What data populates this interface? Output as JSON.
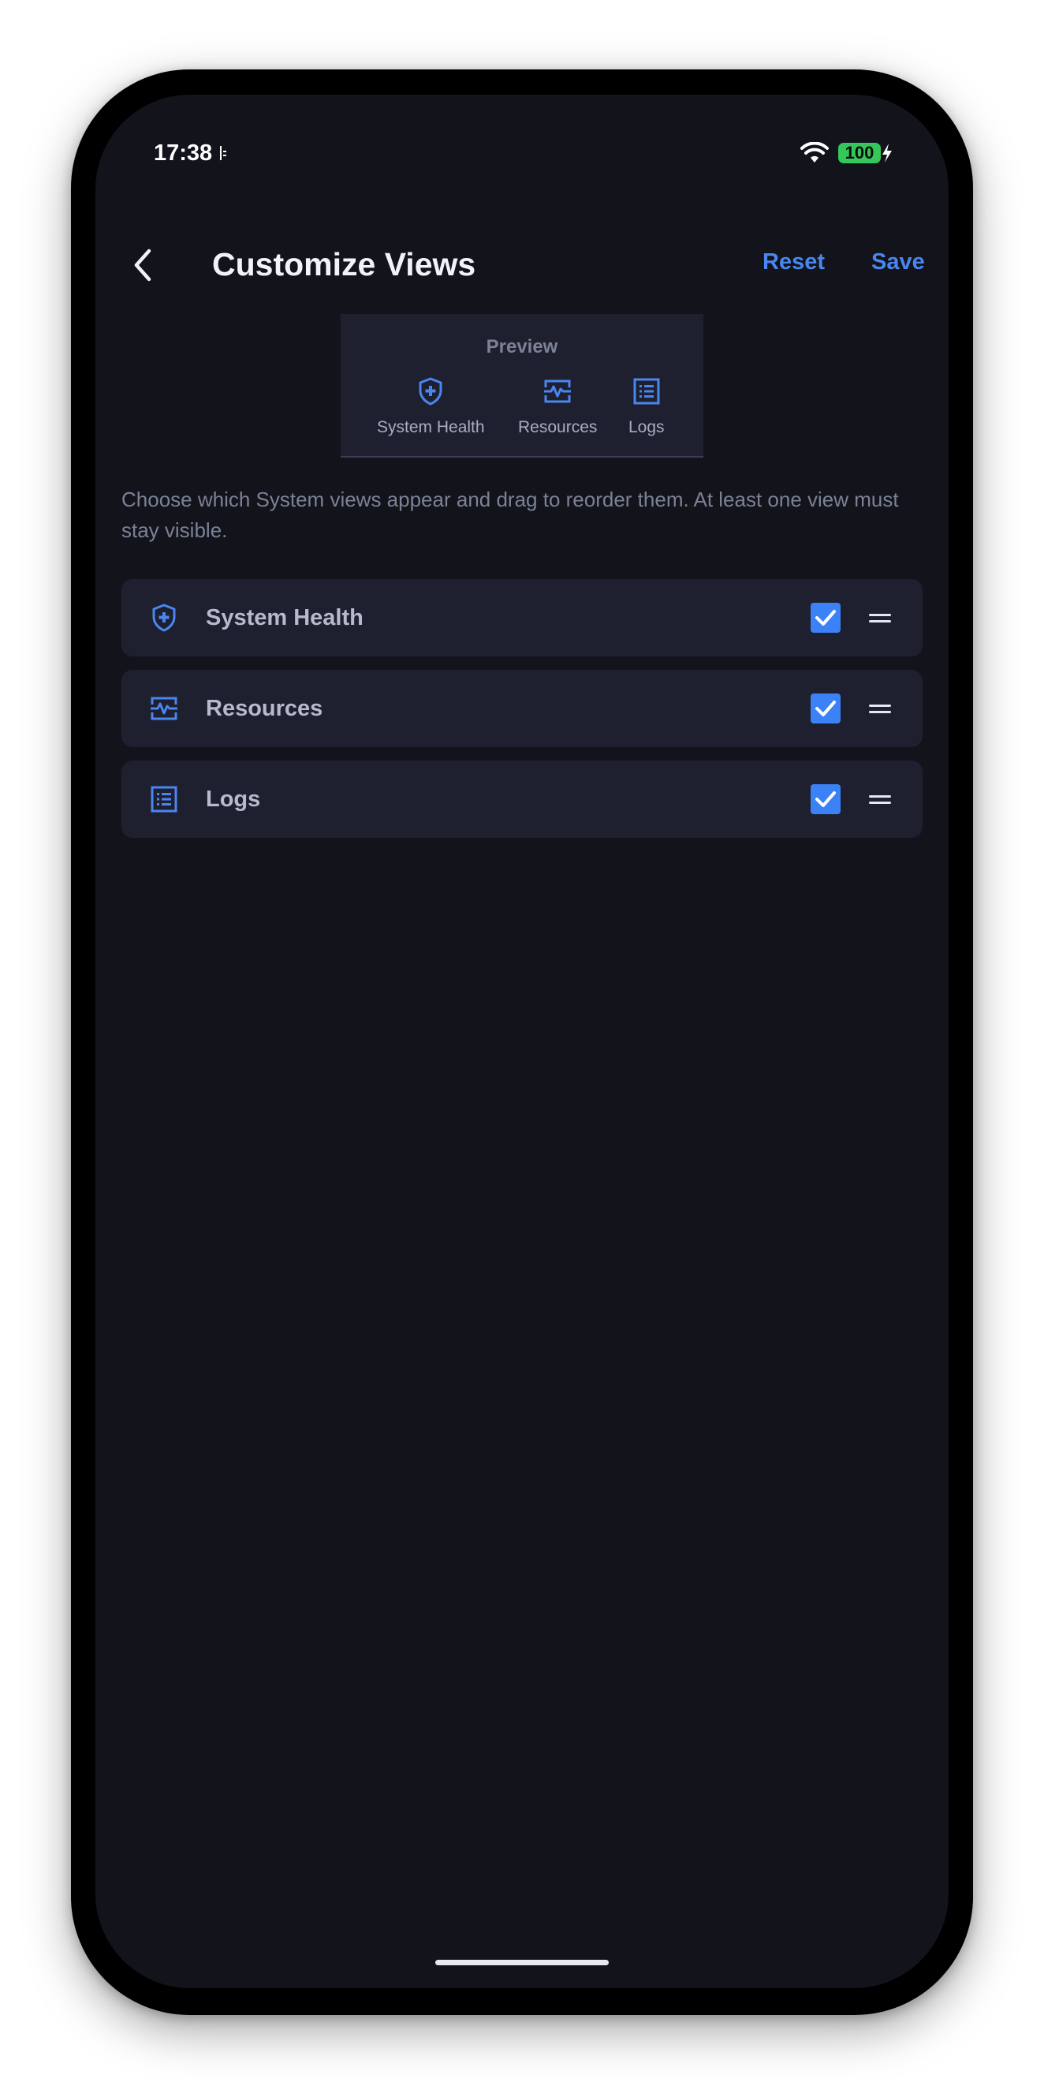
{
  "status_bar": {
    "time": "17:38",
    "battery": "100",
    "battery_color": "#34c759"
  },
  "header": {
    "back_icon": "chevron-left-icon",
    "title": "Customize Views",
    "reset_label": "Reset",
    "save_label": "Save",
    "accent_color": "#4a86ef"
  },
  "preview": {
    "label": "Preview",
    "items": [
      {
        "label": "System Health",
        "icon": "shield-plus-icon"
      },
      {
        "label": "Resources",
        "icon": "activity-monitor-icon"
      },
      {
        "label": "Logs",
        "icon": "list-icon"
      }
    ]
  },
  "description": "Choose which System views appear and drag to reorder them. At least one view must stay visible.",
  "views": [
    {
      "label": "System Health",
      "icon": "shield-plus-icon",
      "checked": true
    },
    {
      "label": "Resources",
      "icon": "activity-monitor-icon",
      "checked": true
    },
    {
      "label": "Logs",
      "icon": "list-icon",
      "checked": true
    }
  ]
}
